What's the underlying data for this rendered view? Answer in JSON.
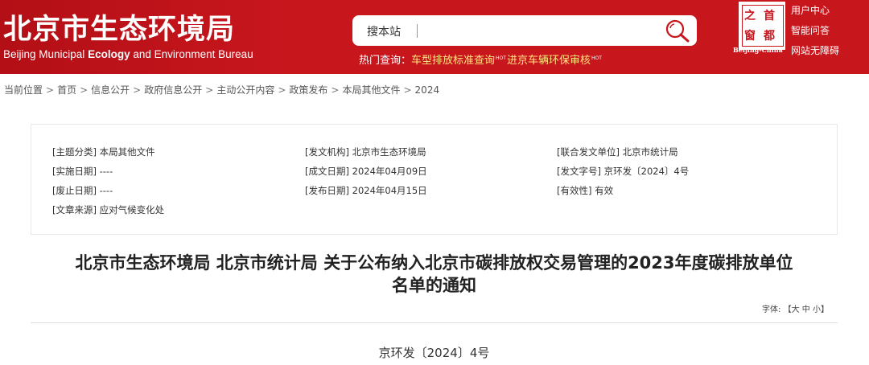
{
  "header": {
    "title_cn": "北京市生态环境局",
    "title_en_1": "Beijing Municipal",
    "title_en_2": "Ecology",
    "title_en_3": "and Environment Bureau",
    "search_label": "搜本站",
    "search_placeholder": "",
    "hot_label": "热门查询：",
    "hot_links": [
      "车型排放标准查询",
      "进京车辆环保审核"
    ],
    "hot_tag": "HOT",
    "badge_chars": [
      "之",
      "首",
      "窗",
      "都"
    ],
    "badge_text": "Beijing-China",
    "top_links": [
      "用户中心",
      "智能问答",
      "网站无障碍"
    ]
  },
  "breadcrumb": [
    "当前位置",
    "首页",
    "信息公开",
    "政府信息公开",
    "主动公开内容",
    "政策发布",
    "本局其他文件",
    "2024"
  ],
  "meta": {
    "topic": "[主题分类] 本局其他文件",
    "issuer": "[发文机构] 北京市生态环境局",
    "joint": "[联合发文单位] 北京市统计局",
    "effective_date": "[实施日期] ----",
    "written_date": "[成文日期] 2024年04月09日",
    "doc_number": "[发文字号] 京环发〔2024〕4号",
    "abolish_date": "[废止日期] ----",
    "publish_date": "[发布日期] 2024年04月15日",
    "validity": "[有效性] 有效",
    "source": "[文章来源] 应对气候变化处"
  },
  "article": {
    "title_line1": "北京市生态环境局 北京市统计局 关于公布纳入北京市碳排放权交易管理的2023年度碳排放单位",
    "title_line2": "名单的通知",
    "font_label": "字体:",
    "font_open": "【",
    "font_sizes": [
      "大",
      "中",
      "小"
    ],
    "font_close": "】",
    "doc_no": "京环发〔2024〕4号"
  },
  "colors": {
    "brand_red": "#c8161d",
    "hot_link": "#ffe680"
  },
  "icons": {
    "search": "magnifier-icon"
  }
}
